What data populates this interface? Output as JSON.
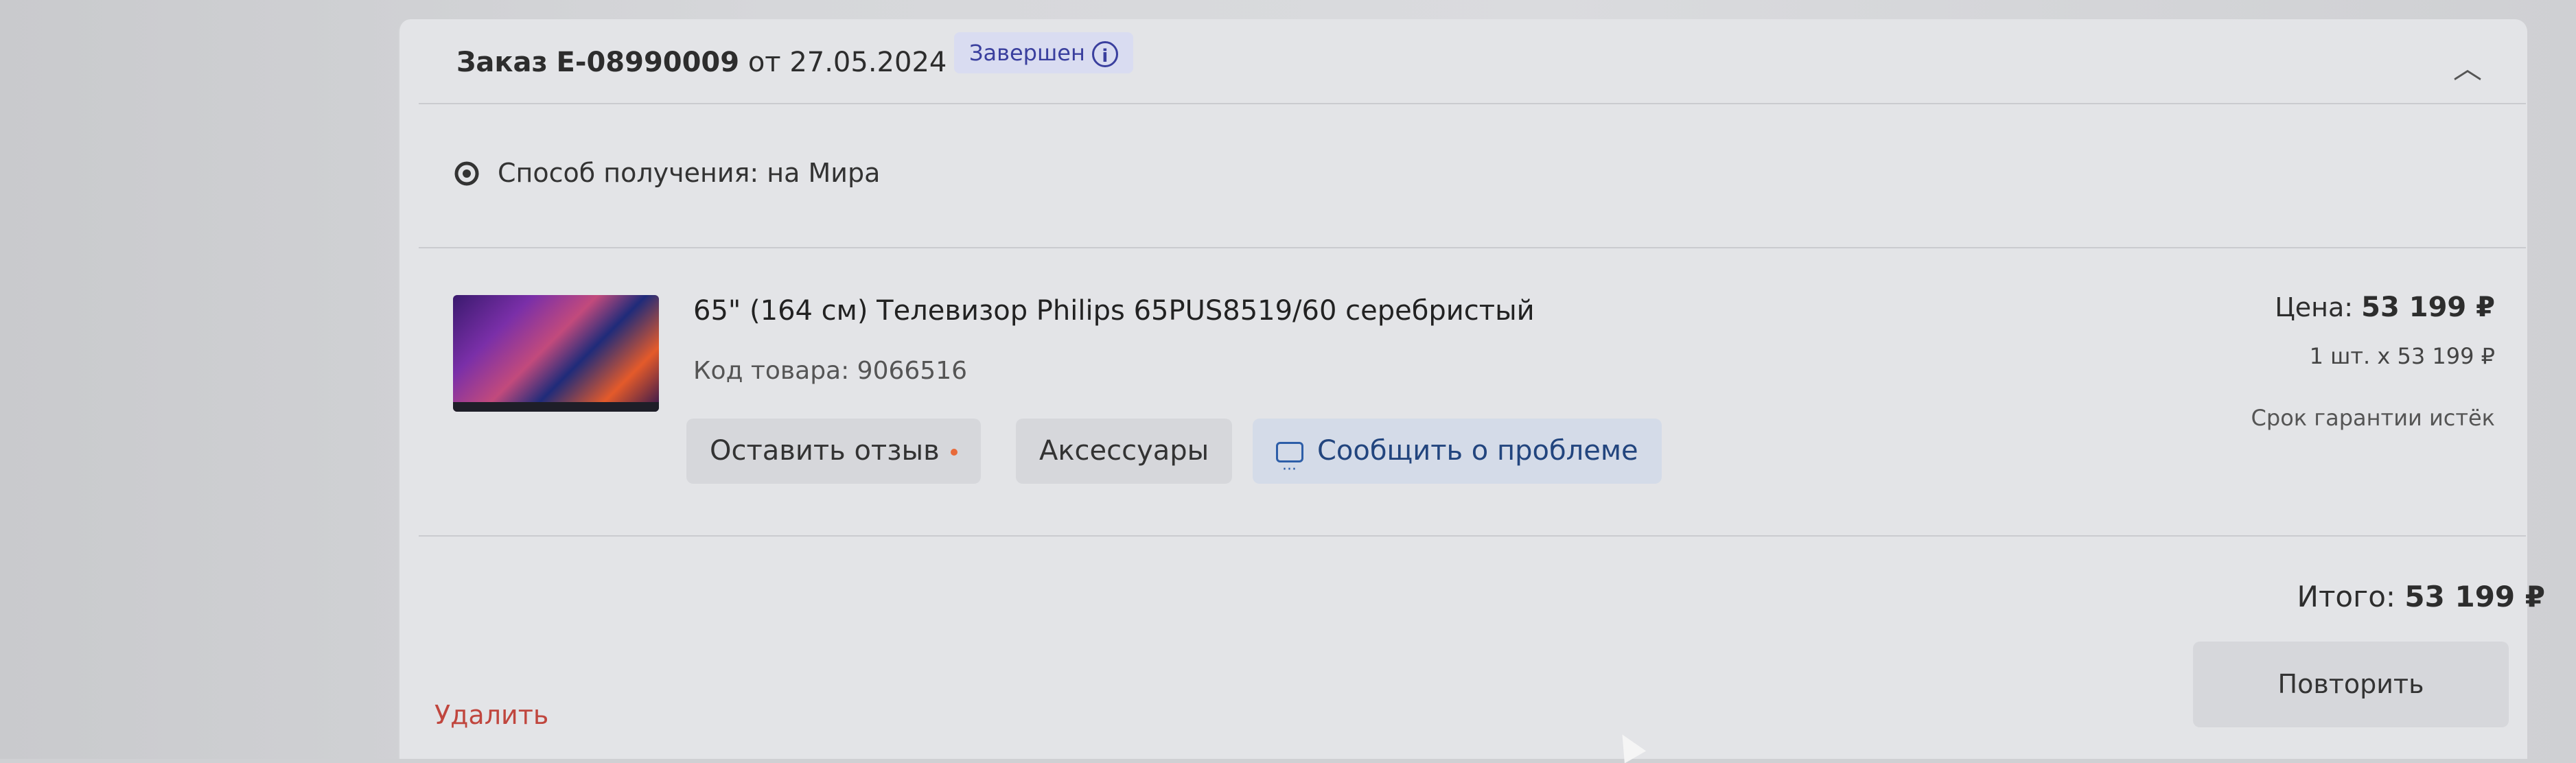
{
  "order": {
    "prefix": "Заказ",
    "number": "E-08990009",
    "date_text": "от 27.05.2024",
    "status": "Завершен",
    "status_info_icon": "info-icon",
    "collapse_icon": "chevron-up-icon",
    "collapse_glyph": "︿"
  },
  "delivery": {
    "icon": "location-pin-icon",
    "text": "Способ получения: на Мира"
  },
  "product": {
    "name": "65\" (164 см) Телевизор Philips 65PUS8519/60 серебристый",
    "code": "Код товара: 9066516",
    "price_label": "Цена:",
    "price": "53 199 ₽",
    "quantity": "1 шт. x 53 199 ₽",
    "warranty": "Срок гарантии истёк",
    "actions": {
      "review": "Оставить отзыв",
      "accessories": "Аксессуары",
      "report": "Сообщить о проблеме"
    }
  },
  "summary": {
    "total_label": "Итого:",
    "total": "53 199 ₽",
    "repeat": "Повторить",
    "delete": "Удалить"
  },
  "colors": {
    "status_bg": "#d9dcf1",
    "status_text": "#3a3f9e",
    "delete_text": "#c0463e",
    "review_dot": "#e86a3a",
    "report_text": "#22457e"
  }
}
